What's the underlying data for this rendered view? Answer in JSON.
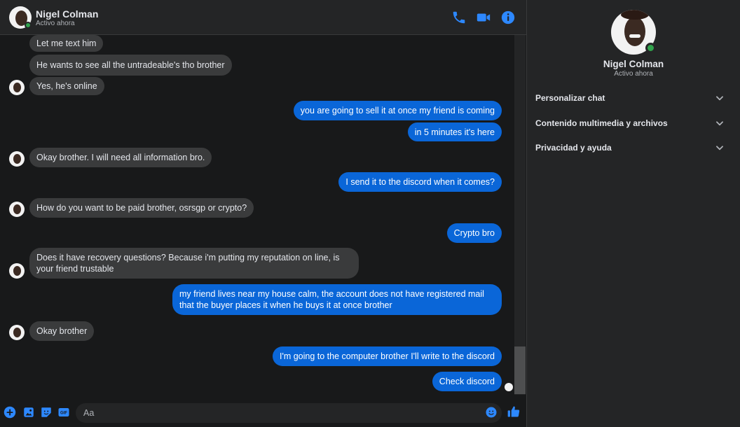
{
  "header": {
    "name": "Nigel Colman",
    "status": "Activo ahora",
    "icons": [
      "phone-icon",
      "video-icon",
      "info-icon"
    ]
  },
  "messages": [
    {
      "side": "in",
      "text": "Let me text him"
    },
    {
      "side": "in",
      "text": "He wants to see all the untradeable's tho brother"
    },
    {
      "side": "in",
      "text": "Yes, he's online"
    },
    {
      "side": "out",
      "text": "you are going to sell it at once my friend is coming"
    },
    {
      "side": "out",
      "text": "in 5 minutes it's here"
    },
    {
      "side": "in",
      "text": "Okay brother. I will need all information bro."
    },
    {
      "side": "out",
      "text": "I send it to the discord when it comes?"
    },
    {
      "side": "in",
      "text": "How do you want to be paid brother, osrsgp or crypto?"
    },
    {
      "side": "out",
      "text": "Crypto bro"
    },
    {
      "side": "in",
      "text": "Does it have recovery questions? Because i'm putting my reputation on line, is your friend trustable"
    },
    {
      "side": "out",
      "text": "my friend lives near my house calm, the account does not have registered mail that the buyer places it when he buys it at once brother"
    },
    {
      "side": "in",
      "text": "Okay brother"
    },
    {
      "side": "out",
      "text": "I'm going to the computer brother I'll write to the discord"
    },
    {
      "side": "out",
      "text": "Check discord"
    }
  ],
  "composer": {
    "placeholder": "Aa",
    "icons": [
      "plus-icon",
      "image-icon",
      "sticker-icon",
      "gif-icon",
      "emoji-icon",
      "like-icon"
    ]
  },
  "info": {
    "name": "Nigel Colman",
    "status": "Activo ahora",
    "sections": [
      {
        "label": "Personalizar chat"
      },
      {
        "label": "Contenido multimedia y archivos"
      },
      {
        "label": "Privacidad y ayuda"
      }
    ]
  },
  "colors": {
    "accent": "#0a66d8",
    "icon_blue": "#2d88ff",
    "online": "#31a24c",
    "incoming_bubble": "#3a3b3c",
    "background": "#18191a"
  }
}
